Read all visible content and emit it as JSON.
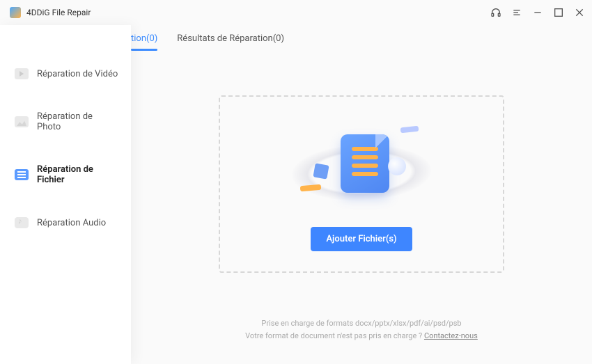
{
  "app": {
    "title": "4DDiG File Repair"
  },
  "sidebar": {
    "items": [
      {
        "label": "Réparation de Vidéo"
      },
      {
        "label": "Réparation de Photo"
      },
      {
        "label": "Réparation de Fichier"
      },
      {
        "label": "Réparation Audio"
      }
    ]
  },
  "tabs": {
    "t1": {
      "label": "tion(0)"
    },
    "t2": {
      "label": "Résultats de Réparation(0)"
    }
  },
  "dropzone": {
    "button": "Ajouter Fichier(s)"
  },
  "footer": {
    "line1": "Prise en charge de formats docx/pptx/xlsx/pdf/ai/psd/psb",
    "line2_prefix": "Votre format de document n'est pas pris en charge ? ",
    "line2_link": "Contactez-nous"
  }
}
